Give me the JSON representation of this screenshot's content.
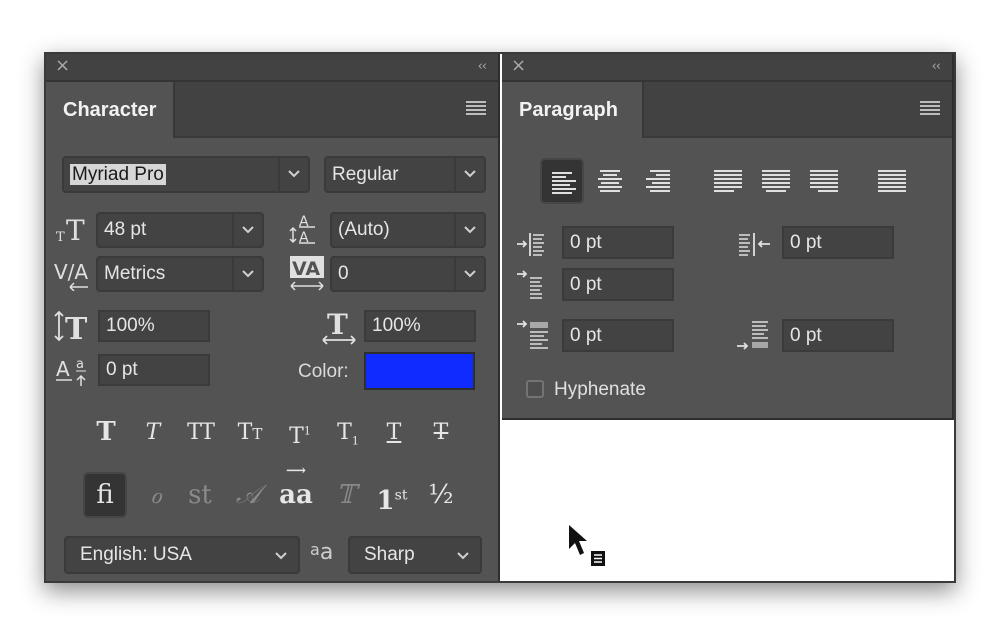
{
  "character_panel": {
    "tab_label": "Character",
    "font_family": "Myriad Pro",
    "font_style": "Regular",
    "font_size": "48 pt",
    "leading": "(Auto)",
    "kerning": "Metrics",
    "tracking": "0",
    "vertical_scale": "100%",
    "horizontal_scale": "100%",
    "baseline_shift": "0 pt",
    "color_label": "Color:",
    "color_value": "#0f2bff",
    "style_buttons": [
      "T",
      "T",
      "TT",
      "Tт",
      "T¹",
      "T₁",
      "T",
      "T"
    ],
    "opentype_buttons": [
      "fi",
      "ℴ",
      "st",
      "𝒜",
      "aa",
      "𝕋",
      "1st",
      "½"
    ],
    "language": "English: USA",
    "antialias_label": "aa",
    "antialias": "Sharp"
  },
  "paragraph_panel": {
    "tab_label": "Paragraph",
    "indent_left": "0 pt",
    "indent_right": "0 pt",
    "indent_first_line": "0 pt",
    "space_before": "0 pt",
    "space_after": "0 pt",
    "hyphenate_label": "Hyphenate",
    "hyphenate_checked": false
  },
  "icons": {
    "close": "×",
    "collapse": "‹‹"
  }
}
